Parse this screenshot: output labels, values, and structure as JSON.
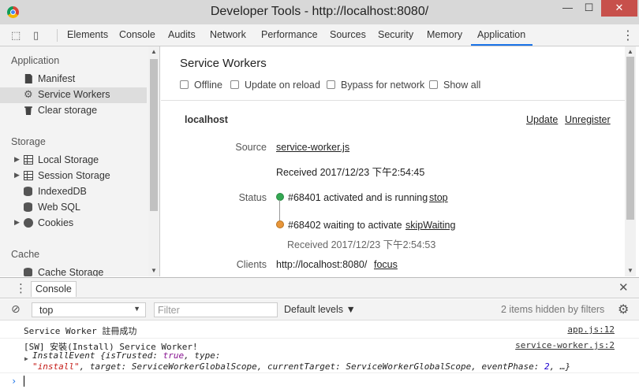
{
  "window": {
    "title": "Developer Tools - http://localhost:8080/",
    "minimize": "—",
    "maximize": "☐",
    "close": "✕"
  },
  "toolbar": {
    "tabs": [
      "Elements",
      "Console",
      "Audits",
      "Network",
      "Performance",
      "Sources",
      "Security",
      "Memory",
      "Application"
    ],
    "active_tab": "Application",
    "more": "⋮"
  },
  "sidebar": {
    "sections": [
      "Application",
      "Storage",
      "Cache"
    ],
    "application_items": [
      "Manifest",
      "Service Workers",
      "Clear storage"
    ],
    "storage_items": [
      "Local Storage",
      "Session Storage",
      "IndexedDB",
      "Web SQL",
      "Cookies"
    ],
    "cache_items": [
      "Cache Storage"
    ],
    "selected": "Service Workers"
  },
  "main": {
    "title": "Service Workers",
    "options": [
      "Offline",
      "Update on reload",
      "Bypass for network",
      "Show all"
    ],
    "origin": "localhost",
    "update_link": "Update",
    "unregister_link": "Unregister",
    "source_label": "Source",
    "source_file": "service-worker.js",
    "received": "Received 2017/12/23 下午2:54:45",
    "status_label": "Status",
    "status_active": "#68401 activated and is running",
    "stop_link": "stop",
    "status_waiting": "#68402 waiting to activate",
    "skip_link": "skipWaiting",
    "received_waiting": "Received 2017/12/23 下午2:54:53",
    "clients_label": "Clients",
    "client_url": "http://localhost:8080/",
    "focus_link": "focus",
    "colors": {
      "active": "#34a853",
      "waiting": "#e8963a"
    }
  },
  "drawer": {
    "tab": "Console",
    "close": "✕",
    "context": "top",
    "filter_placeholder": "Filter",
    "levels": "Default levels ▼",
    "hidden": "2 items hidden by filters"
  },
  "console": {
    "messages": [
      {
        "text": "Service Worker 註冊成功",
        "source": "app.js:12"
      },
      {
        "text": "[SW] 安裝(Install) Service Worker!",
        "source": "service-worker.js:2"
      }
    ],
    "event_line1_a": "InstallEvent {isTrusted: ",
    "event_line1_true": "true",
    "event_line1_b": ", type:",
    "event_line2_str": "\"install\"",
    "event_line2_rest": ", target: ServiceWorkerGlobalScope, currentTarget: ServiceWorkerGlobalScope, eventPhase: ",
    "event_line2_num": "2",
    "event_line2_end": ", …}",
    "prompt": "›"
  }
}
